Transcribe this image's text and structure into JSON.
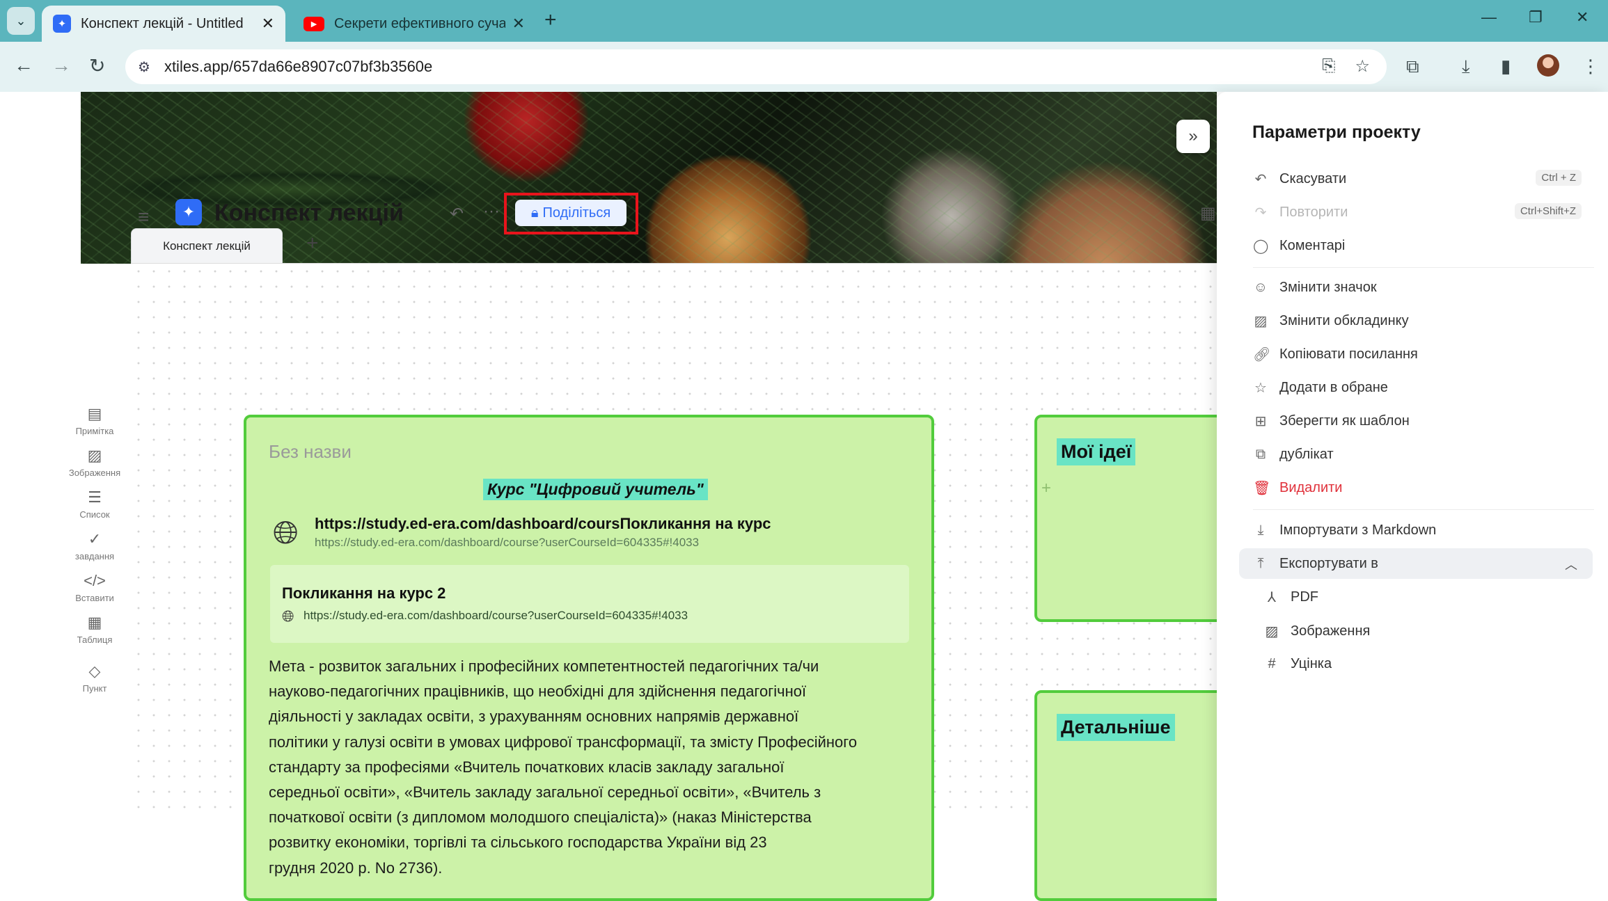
{
  "browser": {
    "tabs": [
      {
        "title": "Конспект лекцій - Untitled",
        "active": true
      },
      {
        "title": "Секрети ефективного сучасно",
        "active": false
      }
    ],
    "url": "xtiles.app/657da66e8907c07bf3b3560e"
  },
  "project": {
    "title": "Конспект лекцій",
    "share_label": "Поділіться",
    "page_tab": "Конспект лекцій"
  },
  "left_tools": [
    {
      "icon": "note-icon",
      "label": "Примітка"
    },
    {
      "icon": "image-icon",
      "label": "Зображення"
    },
    {
      "icon": "list-icon",
      "label": "Список"
    },
    {
      "icon": "task-icon",
      "label": "завдання"
    },
    {
      "icon": "code-icon",
      "label": "Вставити"
    },
    {
      "icon": "table-icon",
      "label": "Таблиця"
    },
    {
      "icon": "point-icon",
      "label": "Пункт"
    }
  ],
  "main_card": {
    "untitled": "Без назви",
    "course_title": "Курс \"Цифровий учитель\"",
    "link1": {
      "title": "https://study.ed-era.com/dashboard/coursПокликання на курс",
      "url": "https://study.ed-era.com/dashboard/course?userCourseId=604335#!4033"
    },
    "link2": {
      "title": "Покликання на курс 2",
      "url": "https://study.ed-era.com/dashboard/course?userCourseId=604335#!4033"
    },
    "body": [
      "Мета - розвиток загальних і професійних компетентностей педагогічних та/чи",
      "науково-педагогічних працівників, що необхідні для здійснення педагогічної",
      "діяльності у закладах освіти, з урахуванням основних напрямів державної",
      "політики у галузі освіти в умовах цифрової трансформації, та змісту Професійного",
      "стандарту за професіями «Вчитель початкових класів закладу загальної",
      "середньої освіти», «Вчитель закладу загальної середньої освіти», «Вчитель з",
      "початкової освіти (з дипломом молодшого спеціаліста)» (наказ Міністерства",
      "розвитку економіки, торгівлі та сільського господарства України від 23",
      "грудня 2020 р. No 2736)."
    ]
  },
  "side_cards": {
    "ideas_title": "Мої ідеї",
    "detail_title": "Детальніше"
  },
  "panel": {
    "title": "Параметри проекту",
    "items": [
      {
        "icon": "undo-icon",
        "label": "Скасувати",
        "shortcut": "Ctrl + Z"
      },
      {
        "icon": "redo-icon",
        "label": "Повторити",
        "shortcut": "Ctrl+Shift+Z"
      },
      {
        "icon": "comment-icon",
        "label": "Коментарі"
      },
      {
        "icon": "emoji-icon",
        "label": "Змінити значок"
      },
      {
        "icon": "cover-icon",
        "label": "Змінити обкладинку"
      },
      {
        "icon": "link-icon",
        "label": "Копіювати посилання"
      },
      {
        "icon": "star-icon",
        "label": "Додати в обране"
      },
      {
        "icon": "template-icon",
        "label": "Зберегти як шаблон"
      },
      {
        "icon": "duplicate-icon",
        "label": "дублікат"
      },
      {
        "icon": "trash-icon",
        "label": "Видалити"
      },
      {
        "icon": "import-icon",
        "label": "Імпортувати з Markdown"
      },
      {
        "icon": "export-icon",
        "label": "Експортувати в"
      }
    ],
    "export_options": [
      {
        "icon": "pdf-icon",
        "label": "PDF"
      },
      {
        "icon": "image-icon",
        "label": "Зображення"
      },
      {
        "icon": "hash-icon",
        "label": "Уцінка"
      }
    ]
  }
}
